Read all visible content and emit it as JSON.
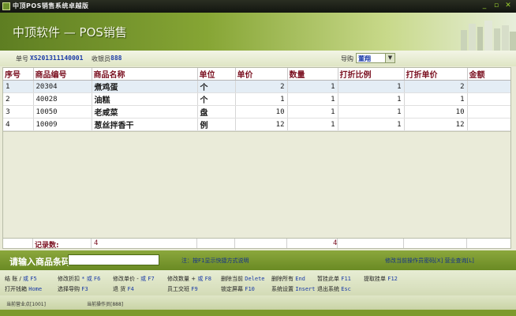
{
  "window": {
    "title": "中顶POS销售系统卓越版"
  },
  "banner": {
    "app_title": "中顶软件 — POS销售"
  },
  "info": {
    "order_no_label": "单号",
    "order_no": "XS201311140001",
    "cashier_label": "收银员",
    "cashier": "888",
    "guide_label": "导购",
    "guide_value": "董翔"
  },
  "table": {
    "headers": [
      "序号",
      "商品编号",
      "商品名称",
      "单位",
      "单价",
      "数量",
      "打折比例",
      "打折单价",
      "金额"
    ],
    "rows": [
      {
        "seq": "1",
        "code": "20304",
        "name": "煮鸡蛋",
        "unit": "个",
        "price": "2",
        "qty": "1",
        "ratio": "1",
        "disc_price": "2",
        "amount": ""
      },
      {
        "seq": "2",
        "code": "40028",
        "name": "油糕",
        "unit": "个",
        "price": "1",
        "qty": "1",
        "ratio": "1",
        "disc_price": "1",
        "amount": ""
      },
      {
        "seq": "3",
        "code": "10050",
        "name": "老咸菜",
        "unit": "盘",
        "price": "10",
        "qty": "1",
        "ratio": "1",
        "disc_price": "10",
        "amount": ""
      },
      {
        "seq": "4",
        "code": "10009",
        "name": "葱丝拌香干",
        "unit": "例",
        "price": "12",
        "qty": "1",
        "ratio": "1",
        "disc_price": "12",
        "amount": ""
      }
    ]
  },
  "summary": {
    "label": "记录数:",
    "count": "4",
    "qty_total": "4"
  },
  "barcode": {
    "label": "请输入商品条码",
    "value": "",
    "hint": "注：按F1显示快捷方式说明",
    "change_password": "修改当前操作员密码[X]  营业查询[L]"
  },
  "fkeys": {
    "settle": "结    账 /",
    "settle_or": "或",
    "settle_key": "F5",
    "discount": "修改折扣",
    "discount_or": "或",
    "discount_key": "F6",
    "unit_price": "修改单价 -",
    "unit_price_or": "或",
    "unit_price_key": "F7",
    "qty": "修改数量 +",
    "qty_or": "或",
    "qty_key": "F8",
    "del": "删除当前",
    "del_key": "Delete",
    "del_all": "删除所有",
    "del_all_key": "End",
    "hold": "暂挂此单",
    "hold_key": "F11",
    "recall": "提取挂单",
    "recall_key": "F12",
    "drawer": "打开钱箱",
    "drawer_key": "Home",
    "guide": "选择导购",
    "guide_key": "F3",
    "refund": "退    货",
    "refund_key": "F4",
    "shift": "员工交班",
    "shift_key": "F9",
    "lock": "锁定屏幕",
    "lock_key": "F10",
    "settings": "系统设置",
    "settings_key": "Insert",
    "exit": "退出系统",
    "exit_key": "Esc"
  },
  "status": {
    "store": "当前营业点[1001]",
    "operator": "当前操作员[888]"
  },
  "colors": {
    "accent": "#7a9a2c",
    "header_text": "#7a1020",
    "value_blue": "#1a3aa8"
  }
}
